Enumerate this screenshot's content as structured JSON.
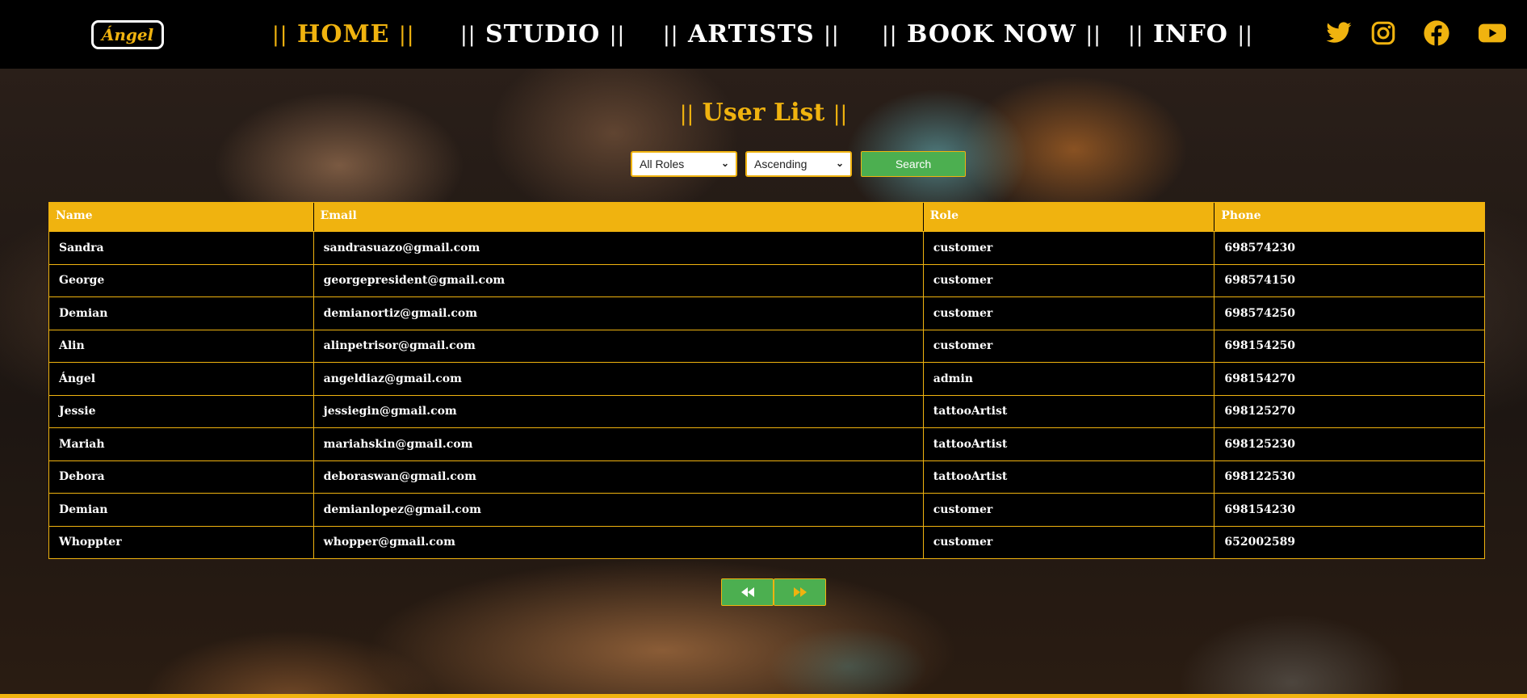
{
  "header": {
    "logo_text": "Ángel",
    "nav": [
      {
        "label": "HOME",
        "active": true
      },
      {
        "label": "STUDIO",
        "active": false
      },
      {
        "label": "ARTISTS",
        "active": false
      },
      {
        "label": "BOOK NOW",
        "active": false
      },
      {
        "label": "INFO",
        "active": false
      }
    ],
    "separator": "||",
    "social_icons": [
      "twitter-icon",
      "instagram-icon",
      "facebook-icon",
      "youtube-icon"
    ]
  },
  "page": {
    "title": "User List"
  },
  "filters": {
    "role_select": "All Roles",
    "order_select": "Ascending",
    "search_label": "Search"
  },
  "table": {
    "columns": [
      "Name",
      "Email",
      "Role",
      "Phone"
    ],
    "rows": [
      [
        "Sandra",
        "sandrasuazo@gmail.com",
        "customer",
        "698574230"
      ],
      [
        "George",
        "georgepresident@gmail.com",
        "customer",
        "698574150"
      ],
      [
        "Demian",
        "demianortiz@gmail.com",
        "customer",
        "698574250"
      ],
      [
        "Alin",
        "alinpetrisor@gmail.com",
        "customer",
        "698154250"
      ],
      [
        "Ángel",
        "angeldiaz@gmail.com",
        "admin",
        "698154270"
      ],
      [
        "Jessie",
        "jessiegin@gmail.com",
        "tattooArtist",
        "698125270"
      ],
      [
        "Mariah",
        "mariahskin@gmail.com",
        "tattooArtist",
        "698125230"
      ],
      [
        "Debora",
        "deboraswan@gmail.com",
        "tattooArtist",
        "698122530"
      ],
      [
        "Demian",
        "demianlopez@gmail.com",
        "customer",
        "698154230"
      ],
      [
        "Whoppter",
        "whopper@gmail.com",
        "customer",
        "652002589"
      ]
    ]
  },
  "pager": {
    "prev_icon": "rewind-icon",
    "next_icon": "fast-forward-icon"
  },
  "colors": {
    "accent": "#f0b30f",
    "button_green": "#4caf50",
    "header_bg": "#000000"
  }
}
